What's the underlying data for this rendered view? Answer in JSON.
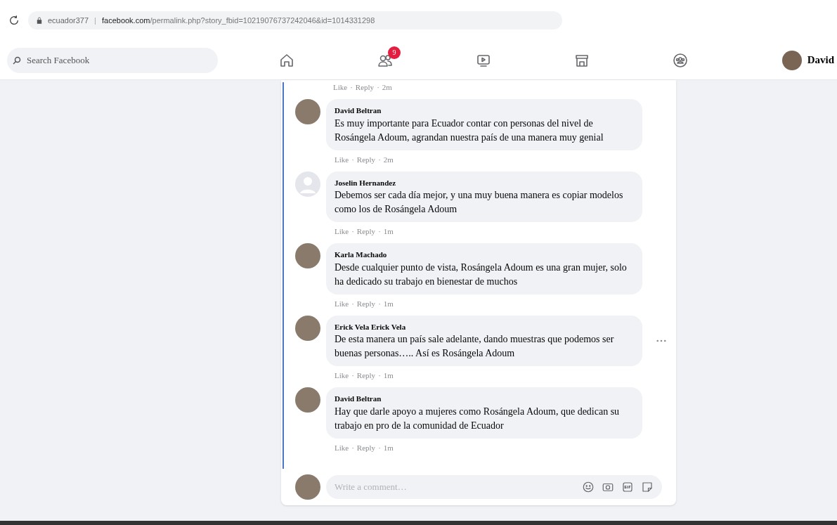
{
  "browser": {
    "site": "ecuador377",
    "divider": "|",
    "url_host": "facebook.com",
    "url_path": "/permalink.php?story_fbid=10219076737242046&id=1014331298"
  },
  "nav": {
    "search": {
      "placeholder": "Search Facebook"
    },
    "friends_badge": "9",
    "profile_name": "David"
  },
  "top_meta": {
    "like": "Like",
    "separator": "·",
    "reply": "Reply",
    "time": "2m"
  },
  "comments": [
    {
      "kind": "photo",
      "author": "David Beltran",
      "text": "Es muy importante para Ecuador contar con personas del nivel de Rosángela Adoum, agrandan nuestra país de una manera muy genial",
      "like": "Like",
      "separator": "·",
      "reply": "Reply",
      "time": "2m",
      "menu_visible": false
    },
    {
      "kind": "default",
      "author": "Joselin Hernandez",
      "text": "Debemos ser cada día mejor, y una muy buena manera es copiar modelos como los de Rosángela Adoum",
      "like": "Like",
      "separator": "·",
      "reply": "Reply",
      "time": "1m",
      "menu_visible": false
    },
    {
      "kind": "photo",
      "author": "Karla Machado",
      "text": "Desde cualquier punto de vista, Rosángela Adoum es una gran mujer, solo ha dedicado su trabajo en bienestar de muchos",
      "like": "Like",
      "separator": "·",
      "reply": "Reply",
      "time": "1m",
      "menu_visible": false
    },
    {
      "kind": "photo",
      "author": "Erick Vela Erick Vela",
      "text": "De esta manera un país sale adelante, dando muestras que podemos ser buenas personas….. Así es Rosángela Adoum",
      "like": "Like",
      "separator": "·",
      "reply": "Reply",
      "time": "1m",
      "menu_visible": true
    },
    {
      "kind": "photo",
      "author": "David Beltran",
      "text": "Hay que darle apoyo a mujeres como Rosángela Adoum, que dedican su trabajo en pro de la comunidad de Ecuador",
      "like": "Like",
      "separator": "·",
      "reply": "Reply",
      "time": "1m",
      "menu_visible": false
    }
  ],
  "composer": {
    "placeholder": "Write a comment…"
  }
}
